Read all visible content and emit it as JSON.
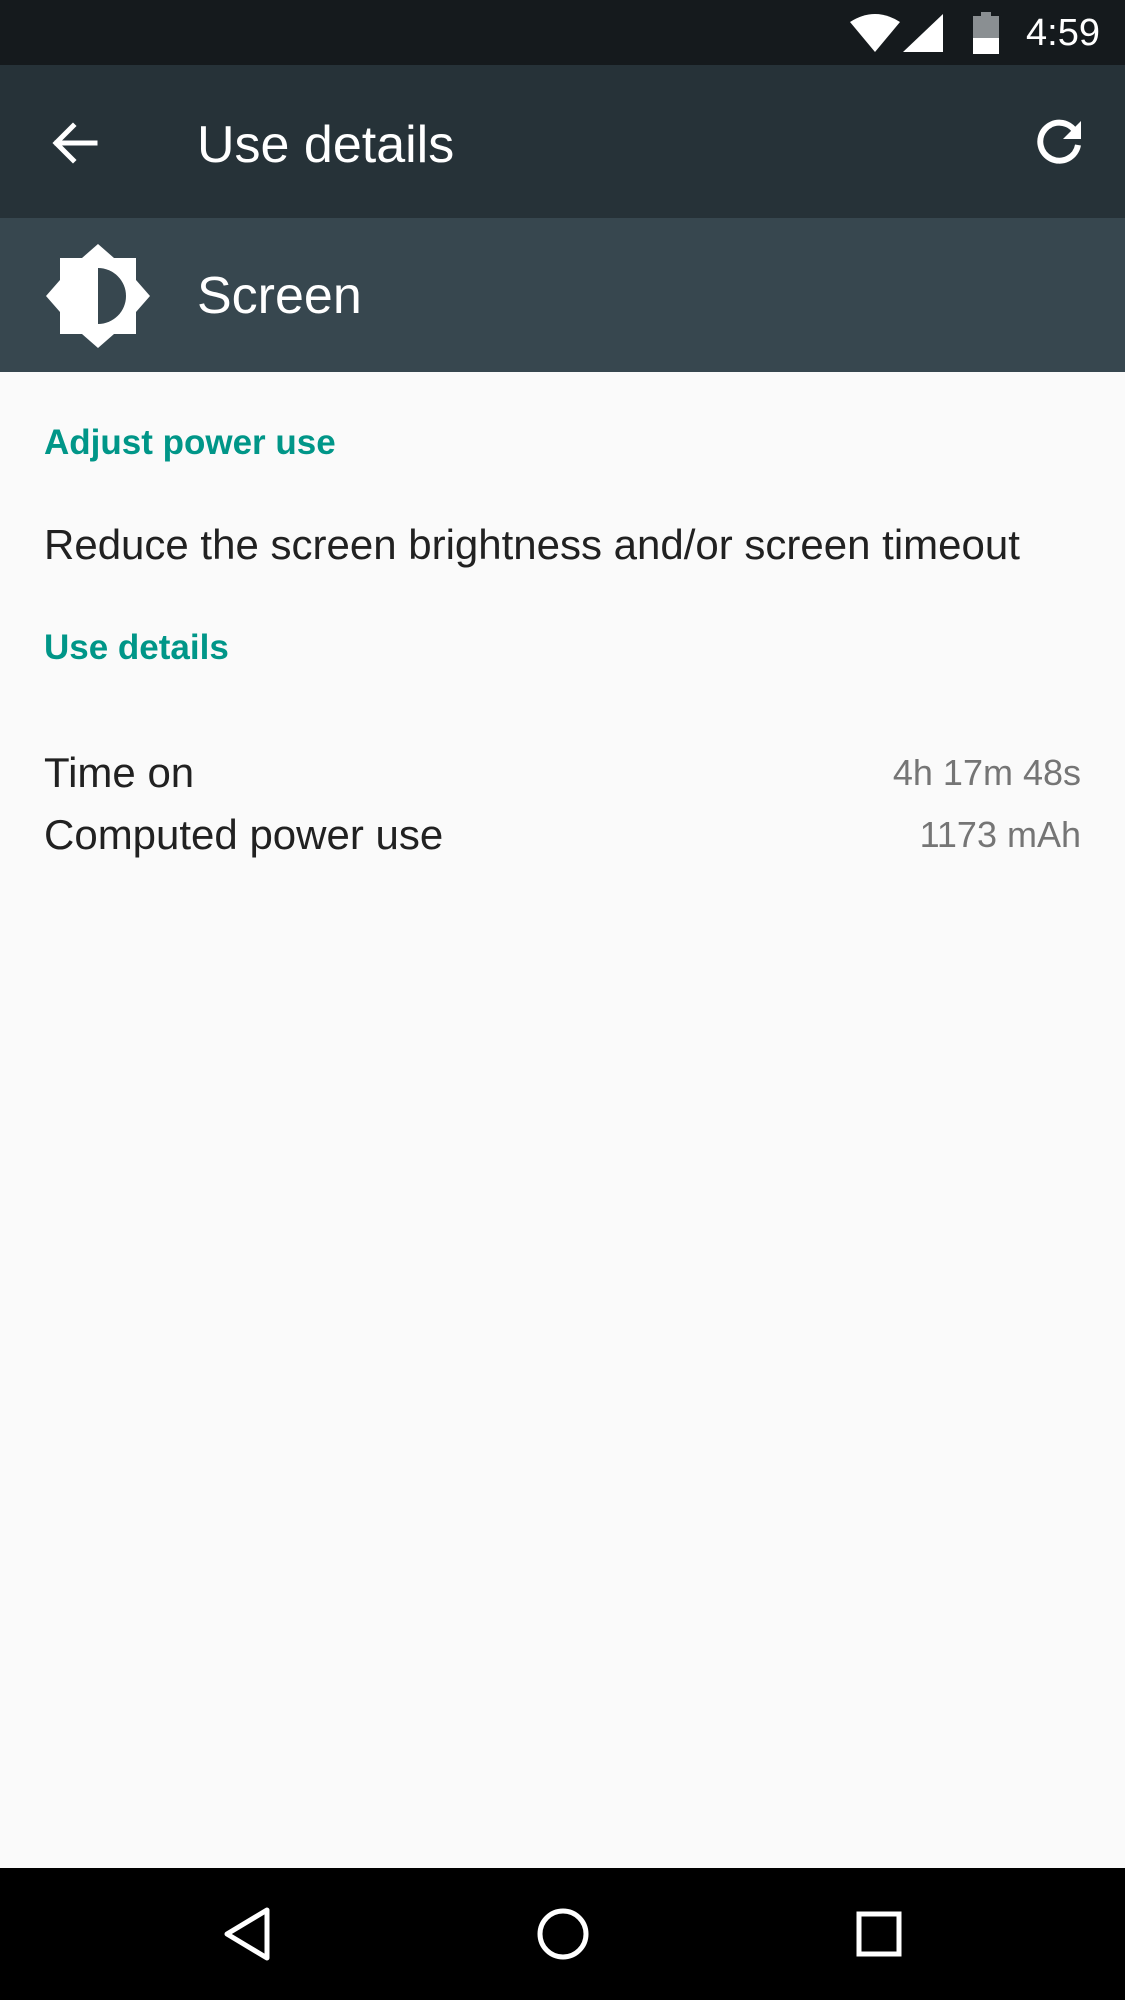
{
  "status_bar": {
    "time": "4:59",
    "icons": [
      "wifi-icon",
      "cell-signal-icon",
      "battery-icon"
    ]
  },
  "app_bar": {
    "title": "Use details",
    "back_icon": "arrow-back-icon",
    "refresh_icon": "refresh-icon"
  },
  "header": {
    "icon": "brightness-icon",
    "label": "Screen"
  },
  "sections": {
    "adjust_heading": "Adjust power use",
    "adjust_text": "Reduce the screen brightness and/or screen timeout",
    "details_heading": "Use details"
  },
  "stats": [
    {
      "label": "Time on",
      "value": "4h 17m 48s"
    },
    {
      "label": "Computed power use",
      "value": "1173 mAh"
    }
  ],
  "nav_bar": {
    "icons": [
      "back-triangle-icon",
      "home-circle-icon",
      "recents-square-icon"
    ]
  },
  "colors": {
    "status_bar": "#151a1d",
    "app_bar": "#263238",
    "header_band": "#37474f",
    "accent": "#009688",
    "background": "#fafafa"
  }
}
